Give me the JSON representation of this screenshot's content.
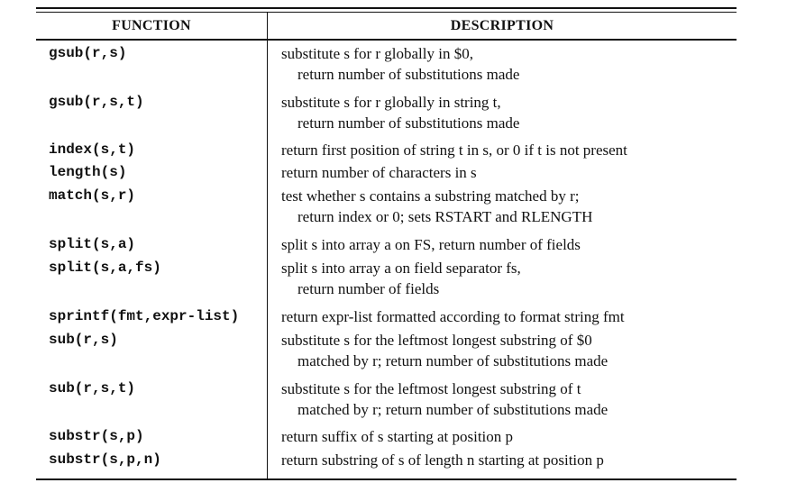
{
  "table": {
    "headers": {
      "function": "FUNCTION",
      "description": "DESCRIPTION"
    },
    "rows": [
      {
        "function": "gsub(r,s)",
        "description": [
          "substitute s for r globally in $0,",
          "return number of substitutions made"
        ]
      },
      {
        "function": "gsub(r,s,t)",
        "description": [
          "substitute s for r globally in string t,",
          "return number of substitutions made"
        ]
      },
      {
        "function": "index(s,t)",
        "description": [
          "return first position of string t in s, or 0 if t is not present"
        ]
      },
      {
        "function": "length(s)",
        "description": [
          "return number of characters in s"
        ]
      },
      {
        "function": "match(s,r)",
        "description": [
          "test whether s contains a substring matched by r;",
          "return index or 0; sets RSTART and RLENGTH"
        ]
      },
      {
        "function": "split(s,a)",
        "description": [
          "split s into array a on FS, return number of fields"
        ]
      },
      {
        "function": "split(s,a,fs)",
        "description": [
          "split s into array a on field separator fs,",
          "return number of fields"
        ]
      },
      {
        "function": "sprintf(fmt,expr-list)",
        "description": [
          "return expr-list formatted according to format string fmt"
        ]
      },
      {
        "function": "sub(r,s)",
        "description": [
          "substitute s for the leftmost longest substring of $0",
          "matched by r; return number of substitutions made"
        ]
      },
      {
        "function": "sub(r,s,t)",
        "description": [
          "substitute s for the leftmost longest substring of t",
          "matched by r; return number of substitutions made"
        ]
      },
      {
        "function": "substr(s,p)",
        "description": [
          "return suffix of s starting at position p"
        ]
      },
      {
        "function": "substr(s,p,n)",
        "description": [
          "return substring of s of length n starting at position p"
        ]
      }
    ]
  }
}
